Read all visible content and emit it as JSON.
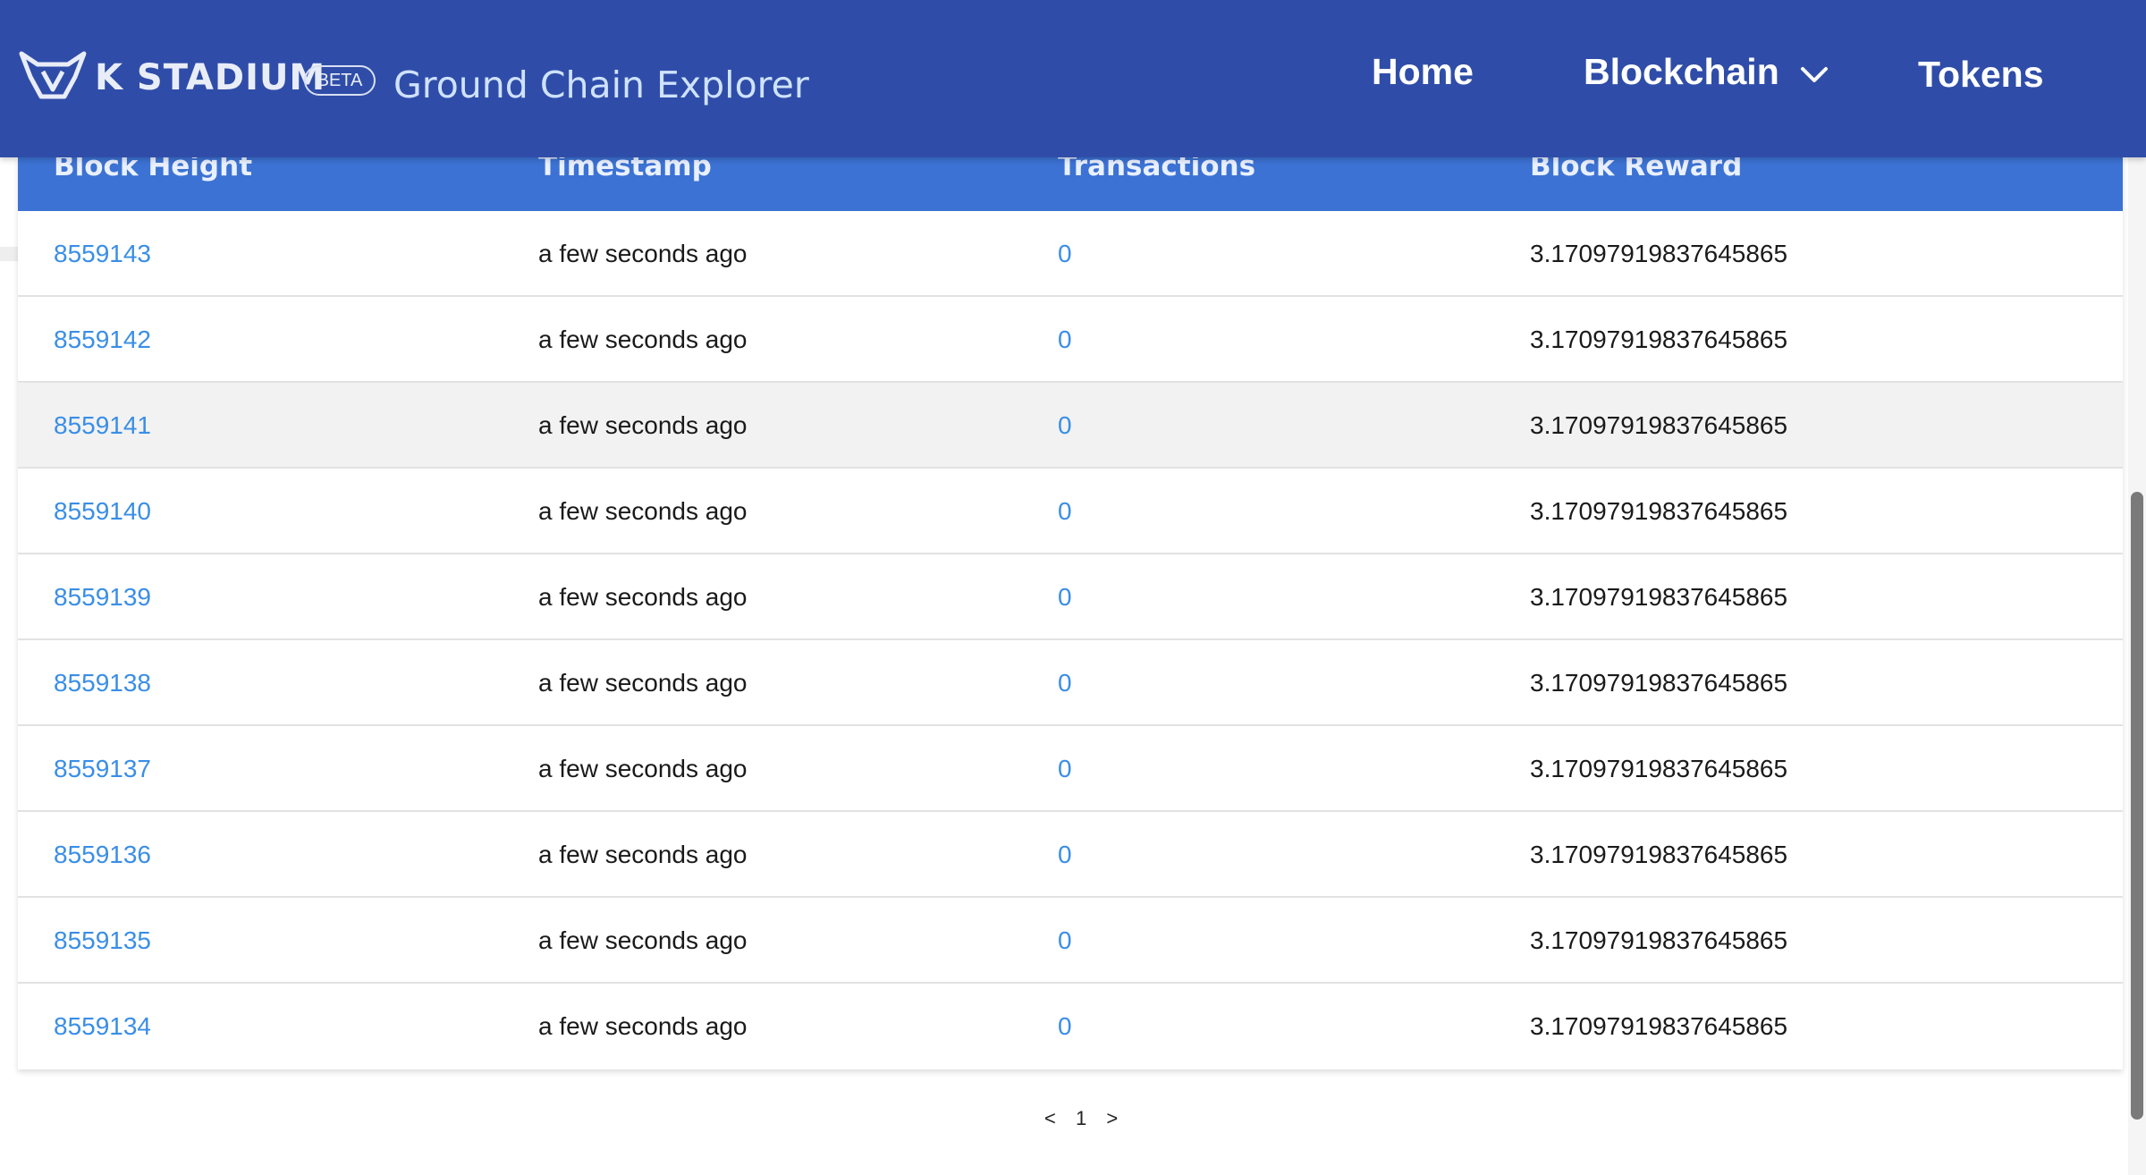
{
  "header": {
    "brand": "K STADIUM",
    "beta_badge": "BETA",
    "app_title": "Ground Chain Explorer",
    "nav": {
      "home": "Home",
      "blockchain": "Blockchain",
      "tokens": "Tokens"
    },
    "colors": {
      "header_bg": "#2f4da8",
      "table_header_bg": "#3c72d4",
      "link": "#3a8ee6"
    }
  },
  "table": {
    "columns": [
      "Block Height",
      "Timestamp",
      "Transactions",
      "Block Reward"
    ],
    "rows": [
      {
        "block_height": "8559143",
        "timestamp": "a few seconds ago",
        "transactions": "0",
        "block_reward": "3.17097919837645865"
      },
      {
        "block_height": "8559142",
        "timestamp": "a few seconds ago",
        "transactions": "0",
        "block_reward": "3.17097919837645865"
      },
      {
        "block_height": "8559141",
        "timestamp": "a few seconds ago",
        "transactions": "0",
        "block_reward": "3.17097919837645865"
      },
      {
        "block_height": "8559140",
        "timestamp": "a few seconds ago",
        "transactions": "0",
        "block_reward": "3.17097919837645865"
      },
      {
        "block_height": "8559139",
        "timestamp": "a few seconds ago",
        "transactions": "0",
        "block_reward": "3.17097919837645865"
      },
      {
        "block_height": "8559138",
        "timestamp": "a few seconds ago",
        "transactions": "0",
        "block_reward": "3.17097919837645865"
      },
      {
        "block_height": "8559137",
        "timestamp": "a few seconds ago",
        "transactions": "0",
        "block_reward": "3.17097919837645865"
      },
      {
        "block_height": "8559136",
        "timestamp": "a few seconds ago",
        "transactions": "0",
        "block_reward": "3.17097919837645865"
      },
      {
        "block_height": "8559135",
        "timestamp": "a few seconds ago",
        "transactions": "0",
        "block_reward": "3.17097919837645865"
      },
      {
        "block_height": "8559134",
        "timestamp": "a few seconds ago",
        "transactions": "0",
        "block_reward": "3.17097919837645865"
      }
    ]
  },
  "pagination": {
    "prev": "<",
    "page": "1",
    "next": ">"
  },
  "icons": {
    "logo": "kstadium-logo-icon",
    "dropdown": "chevron-down-icon"
  }
}
